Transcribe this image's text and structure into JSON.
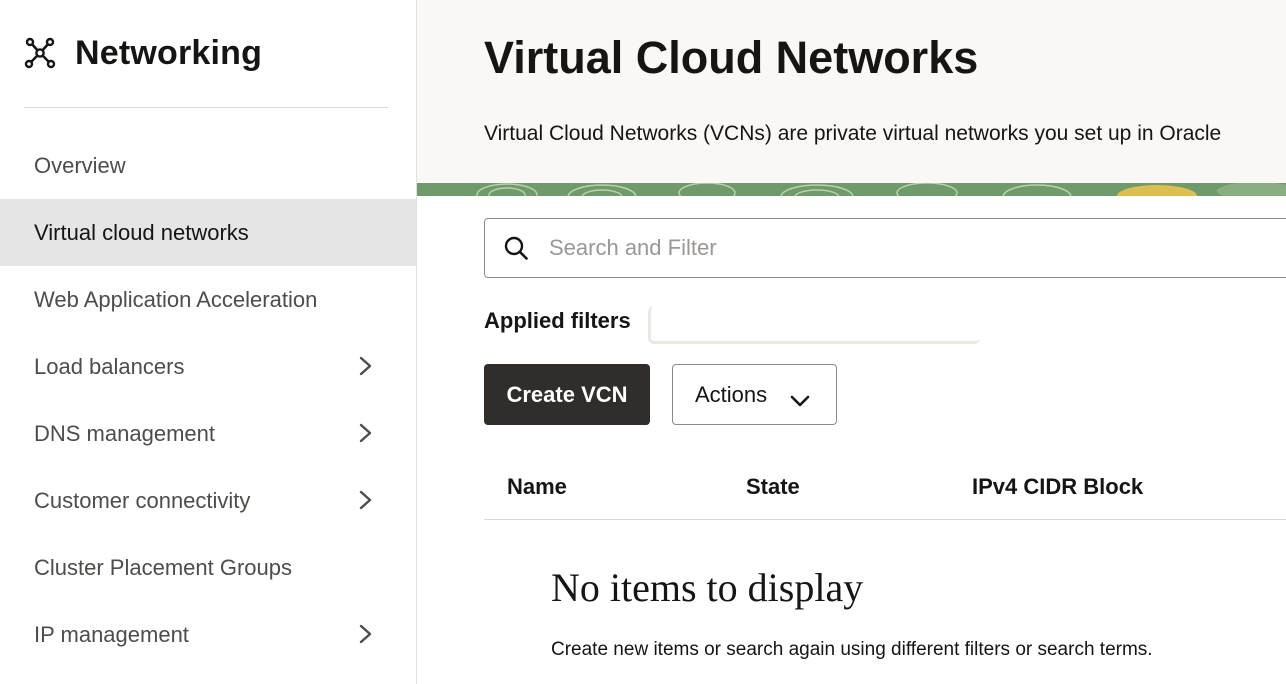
{
  "sidebar": {
    "title": "Networking",
    "icon": "network-icon",
    "items": [
      {
        "label": "Overview",
        "active": false,
        "has_submenu": false
      },
      {
        "label": "Virtual cloud networks",
        "active": true,
        "has_submenu": false
      },
      {
        "label": "Web Application Acceleration",
        "active": false,
        "has_submenu": false
      },
      {
        "label": "Load balancers",
        "active": false,
        "has_submenu": true
      },
      {
        "label": "DNS management",
        "active": false,
        "has_submenu": true
      },
      {
        "label": "Customer connectivity",
        "active": false,
        "has_submenu": true
      },
      {
        "label": "Cluster Placement Groups",
        "active": false,
        "has_submenu": false
      },
      {
        "label": "IP management",
        "active": false,
        "has_submenu": true
      }
    ]
  },
  "header": {
    "title": "Virtual Cloud Networks",
    "description": "Virtual Cloud Networks (VCNs) are private virtual networks you set up in Oracle"
  },
  "search": {
    "placeholder": "Search and Filter",
    "value": "",
    "icon": "search-icon"
  },
  "filters": {
    "label": "Applied filters"
  },
  "toolbar": {
    "create_label": "Create VCN",
    "actions_label": "Actions"
  },
  "table": {
    "columns": [
      "Name",
      "State",
      "IPv4 CIDR Block"
    ],
    "empty_title": "No items to display",
    "empty_description": "Create new items or search again using different filters or search terms."
  },
  "colors": {
    "primary_button": "#312d2a",
    "active_nav_bg": "#e5e5e5",
    "header_bg": "#f9f8f6"
  }
}
